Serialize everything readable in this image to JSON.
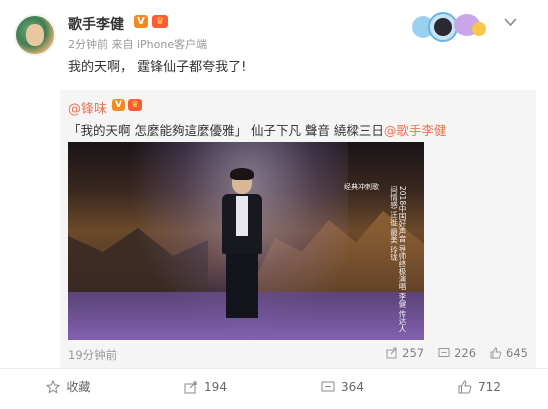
{
  "post": {
    "author": "歌手李健",
    "meta": "2分钟前 来自 iPhone客户端",
    "text": "我的天啊， 霆锋仙子都夸我了!"
  },
  "repost": {
    "author": "@锋味",
    "text_main": "「我的天啊 怎麼能夠這麼優雅」 仙子下凡 聲音 繞樑三日",
    "text_mention": "@歌手李健",
    "video_caption_top": "经典冲刺歌",
    "video_caption": "2018中国好声音 导师终极演唱 李健 传达人间情感 迁徙 最美 玲珑",
    "time": "19分钟前",
    "stats": {
      "reposts": "257",
      "comments": "226",
      "likes": "645"
    }
  },
  "actions": {
    "favorite": "收藏",
    "repost": "194",
    "comment": "364",
    "like": "712"
  },
  "colors": {
    "accent": "#eb7350",
    "vip": "#f28b1f",
    "muted": "#999999"
  }
}
